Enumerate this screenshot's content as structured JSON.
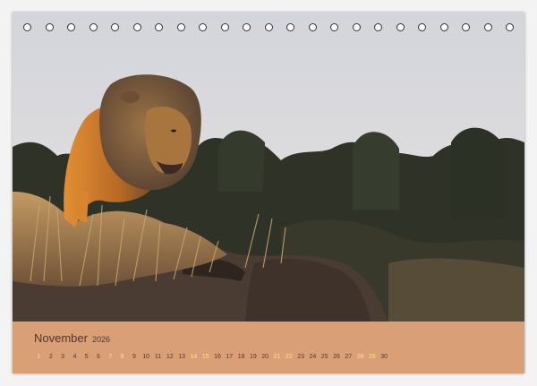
{
  "calendar": {
    "month": "November",
    "year": "2026",
    "weekday_abbreviations": [
      "",
      "",
      "",
      "",
      "",
      "",
      "",
      "",
      "",
      "",
      "",
      "",
      "",
      "",
      "",
      "",
      "",
      "",
      "",
      "",
      "",
      "",
      "",
      "",
      "",
      "",
      "",
      "",
      "",
      ""
    ],
    "days": [
      "1",
      "2",
      "3",
      "4",
      "5",
      "6",
      "7",
      "8",
      "9",
      "10",
      "11",
      "12",
      "13",
      "14",
      "15",
      "16",
      "17",
      "18",
      "19",
      "20",
      "21",
      "22",
      "23",
      "24",
      "25",
      "26",
      "27",
      "28",
      "29",
      "30"
    ],
    "highlight_days": [
      "1",
      "7",
      "8",
      "14",
      "15",
      "21",
      "22",
      "28",
      "29"
    ]
  },
  "photo": {
    "subject": "lion-standing-on-rocky-hill-at-sunset",
    "colors": {
      "sky": "#d6d8df",
      "trees": "#2f3327",
      "grass": "#a98255",
      "rock": "#4a3c33",
      "lion_lit": "#d98a33"
    }
  },
  "colors": {
    "band": "#d9a078",
    "text": "#4a3a31",
    "highlight": "#ffe36a",
    "ring": "#333333"
  }
}
